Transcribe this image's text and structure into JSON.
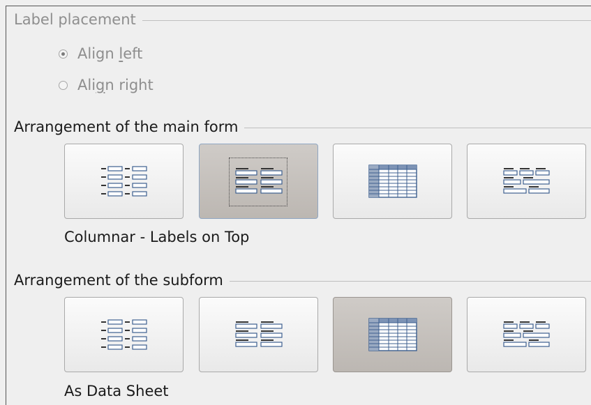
{
  "label_placement": {
    "title": "Label placement",
    "options": [
      {
        "label_pre": "Align ",
        "label_u": "l",
        "label_post": "eft",
        "checked": true
      },
      {
        "label_pre": "Ali",
        "label_u": "g",
        "label_post": "n right",
        "checked": false
      }
    ]
  },
  "main_form": {
    "title": "Arrangement of the main form",
    "layouts": [
      {
        "icon": "columnar-labels-left-icon",
        "selected": false
      },
      {
        "icon": "columnar-labels-on-top-icon",
        "selected": true
      },
      {
        "icon": "data-sheet-icon",
        "selected": false
      },
      {
        "icon": "in-blocks-labels-above-icon",
        "selected": false
      }
    ],
    "selected_caption": "Columnar - Labels on Top"
  },
  "subform": {
    "title": "Arrangement of the subform",
    "layouts": [
      {
        "icon": "columnar-labels-left-icon",
        "selected": false
      },
      {
        "icon": "columnar-labels-on-top-icon",
        "selected": false
      },
      {
        "icon": "data-sheet-icon",
        "selected": true
      },
      {
        "icon": "in-blocks-labels-above-icon",
        "selected": false
      }
    ],
    "selected_caption": "As Data Sheet"
  },
  "colors": {
    "background": "#efefef",
    "selected_button": "#c4c0bc",
    "icon_blue": "#3d5f8f"
  }
}
